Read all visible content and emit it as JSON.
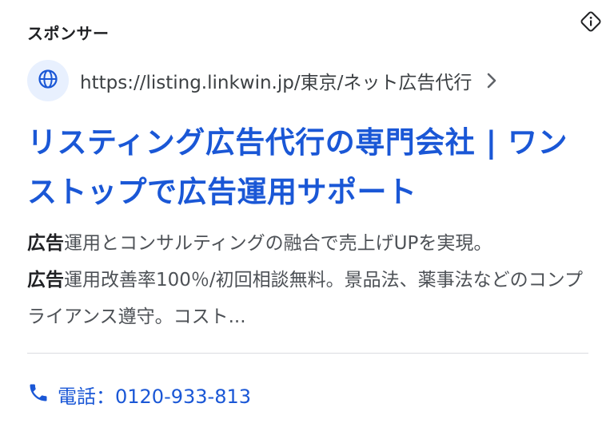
{
  "ad": {
    "sponsor_label": "スポンサー",
    "info_icon": "info-diamond-icon",
    "url": {
      "icon": "globe-icon",
      "text": "https://listing.linkwin.jp/東京/ネット広告代行",
      "chevron_icon": "chevron-right-icon"
    },
    "headline": "リスティング広告代行の専門会社 | ワンストップで広告運用サポート",
    "description": [
      {
        "bold": "広告",
        "text": "運用とコンサルティングの融合で売上げUPを実現。"
      },
      {
        "bold": "広告",
        "text": "運用改善率100％/初回相談無料。景品法、薬事法などのコンプライアンス遵守。コスト..."
      }
    ],
    "call": {
      "icon": "phone-icon",
      "text": "電話：0120-933-813"
    }
  },
  "colors": {
    "headline": "#1a57d6",
    "link": "#1a57d6",
    "badge_bg": "#e8f0fe",
    "body_text": "#4d5156",
    "divider": "#dadce0"
  }
}
